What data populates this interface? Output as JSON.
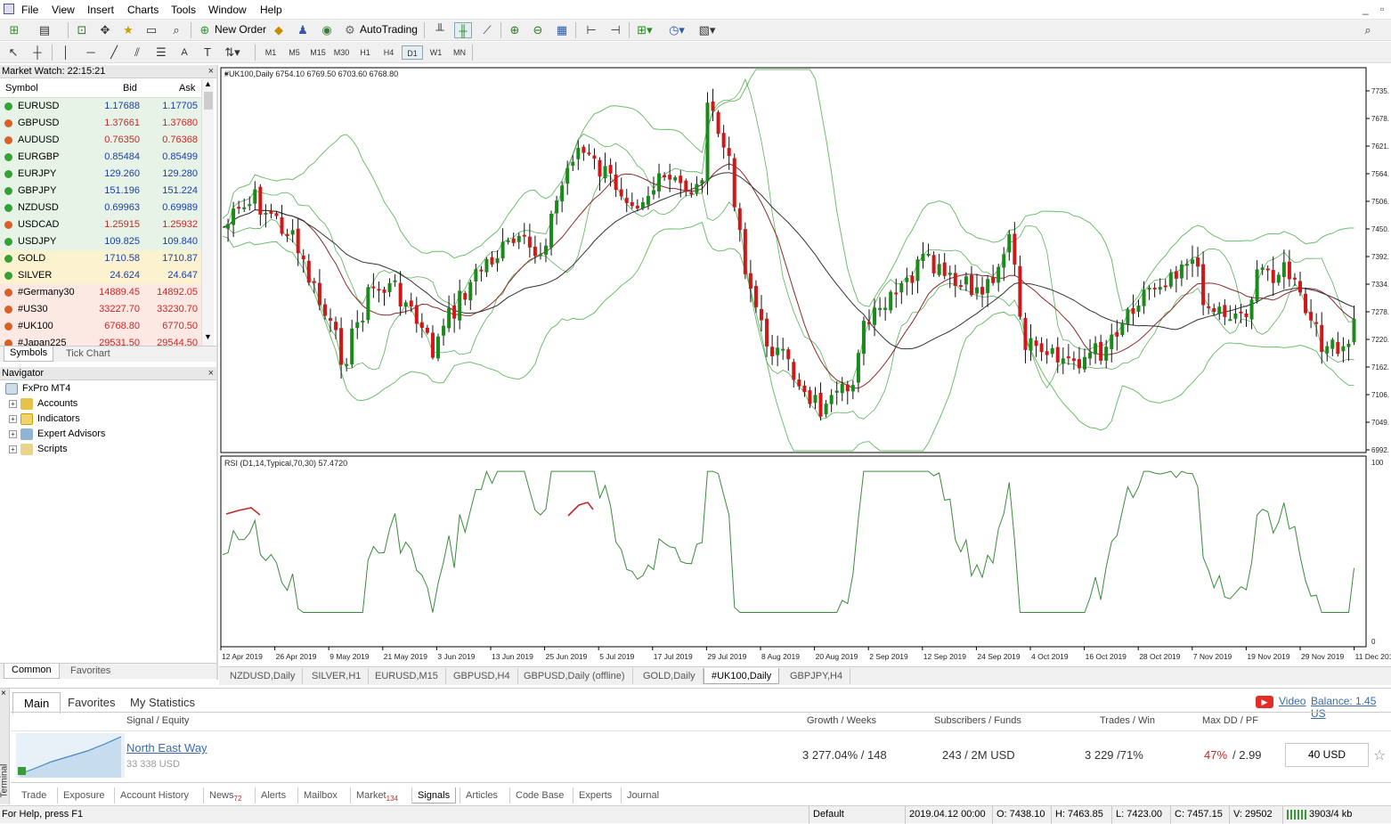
{
  "menu": [
    "File",
    "View",
    "Insert",
    "Charts",
    "Tools",
    "Window",
    "Help"
  ],
  "toolbar": {
    "new_order": "New Order",
    "autotrading": "AutoTrading"
  },
  "timeframes": [
    "M1",
    "M5",
    "M15",
    "M30",
    "H1",
    "H4",
    "D1",
    "W1",
    "MN"
  ],
  "market_watch": {
    "title": "Market Watch: 22:15:21",
    "col_symbol": "Symbol",
    "col_bid": "Bid",
    "col_ask": "Ask",
    "rows": [
      {
        "symbol": "EURUSD",
        "bid": "1.17688",
        "ask": "1.17705",
        "dir": "up"
      },
      {
        "symbol": "GBPUSD",
        "bid": "1.37661",
        "ask": "1.37680",
        "dir": "down"
      },
      {
        "symbol": "AUDUSD",
        "bid": "0.76350",
        "ask": "0.76368",
        "dir": "down"
      },
      {
        "symbol": "EURGBP",
        "bid": "0.85484",
        "ask": "0.85499",
        "dir": "up"
      },
      {
        "symbol": "EURJPY",
        "bid": "129.260",
        "ask": "129.280",
        "dir": "up"
      },
      {
        "symbol": "GBPJPY",
        "bid": "151.196",
        "ask": "151.224",
        "dir": "up"
      },
      {
        "symbol": "NZDUSD",
        "bid": "0.69963",
        "ask": "0.69989",
        "dir": "up"
      },
      {
        "symbol": "USDCAD",
        "bid": "1.25915",
        "ask": "1.25932",
        "dir": "down"
      },
      {
        "symbol": "USDJPY",
        "bid": "109.825",
        "ask": "109.840",
        "dir": "up"
      },
      {
        "symbol": "GOLD",
        "bid": "1710.58",
        "ask": "1710.87",
        "dir": "up"
      },
      {
        "symbol": "SILVER",
        "bid": "24.624",
        "ask": "24.647",
        "dir": "up"
      },
      {
        "symbol": "#Germany30",
        "bid": "14889.45",
        "ask": "14892.05",
        "dir": "down"
      },
      {
        "symbol": "#US30",
        "bid": "33227.70",
        "ask": "33230.70",
        "dir": "down"
      },
      {
        "symbol": "#UK100",
        "bid": "6768.80",
        "ask": "6770.50",
        "dir": "down"
      },
      {
        "symbol": "#Japan225",
        "bid": "29531.50",
        "ask": "29544.50",
        "dir": "down"
      }
    ],
    "tabs": [
      "Symbols",
      "Tick Chart"
    ]
  },
  "navigator": {
    "title": "Navigator",
    "root": "FxPro MT4",
    "items": [
      {
        "label": "Accounts",
        "icon": "accounts-icon"
      },
      {
        "label": "Indicators",
        "icon": "indicators-icon"
      },
      {
        "label": "Expert Advisors",
        "icon": "expert-advisors-icon"
      },
      {
        "label": "Scripts",
        "icon": "scripts-icon"
      }
    ],
    "tabs": [
      "Common",
      "Favorites"
    ]
  },
  "chart": {
    "header": "#UK100,Daily  6754.10 6769.50 6703.60 6768.80",
    "rsi_header": "RSI (D1,14,Typical,70,30) 57.4720",
    "rsi_max": "100",
    "rsi_min": "0",
    "price_ticks": [
      "7735.",
      "7678.",
      "7621.",
      "7564.",
      "7506.",
      "7450.",
      "7392.",
      "7334.",
      "7278.",
      "7220.",
      "7162.",
      "7106.",
      "7049.",
      "6992."
    ],
    "date_ticks": [
      "12 Apr 2019",
      "26 Apr 2019",
      "9 May 2019",
      "21 May 2019",
      "3 Jun 2019",
      "13 Jun 2019",
      "25 Jun 2019",
      "5 Jul 2019",
      "17 Jul 2019",
      "29 Jul 2019",
      "8 Aug 2019",
      "20 Aug 2019",
      "2 Sep 2019",
      "12 Sep 2019",
      "24 Sep 2019",
      "4 Oct 2019",
      "16 Oct 2019",
      "28 Oct 2019",
      "7 Nov 2019",
      "19 Nov 2019",
      "29 Nov 2019",
      "11 Dec 201"
    ],
    "colors": {
      "bull": "#1a8a1a",
      "bear": "#d01818",
      "bollinger": "#6cbf6c",
      "ma_dark": "#333333",
      "ma_red": "#8b2a2a",
      "ma_green": "#2e9e2e",
      "rsi": "#3c8a3c",
      "rsi_hot": "#c42a2a"
    }
  },
  "chart_tabs": [
    "NZDUSD,Daily",
    "SILVER,H1",
    "EURUSD,M15",
    "GBPUSD,H4",
    "GBPUSD,Daily (offline)",
    "GOLD,Daily",
    "#UK100,Daily",
    "GBPJPY,H4"
  ],
  "terminal": {
    "side_label": "Terminal",
    "top_tabs": [
      "Main",
      "Favorites",
      "My Statistics"
    ],
    "video": "Video",
    "balance": "Balance: 1.45 US",
    "headers": {
      "signal": "Signal / Equity",
      "growth": "Growth / Weeks",
      "subs": "Subscribers / Funds",
      "trades": "Trades / Win",
      "dd": "Max DD / PF"
    },
    "signal": {
      "name": "North East Way",
      "equity": "33 338 USD",
      "growth": "3 277.04% / 148",
      "subs": "243 / 2M USD",
      "trades": "3 229 /71%",
      "dd_pct": "47%",
      "pf": "/ 2.99",
      "price": "40 USD"
    },
    "bottom_tabs": [
      "Trade",
      "Exposure",
      "Account History",
      "News",
      "Alerts",
      "Mailbox",
      "Market",
      "Signals",
      "Articles",
      "Code Base",
      "Experts",
      "Journal"
    ],
    "news_count": "72",
    "market_count": "134"
  },
  "status": {
    "help": "For Help, press F1",
    "profile": "Default",
    "time": "2019.04.12 00:00",
    "open": "O: 7438.10",
    "high": "H: 7463.85",
    "low": "L: 7423.00",
    "close": "C: 7457.15",
    "volume": "V: 29502",
    "traffic": "3903/4 kb"
  }
}
